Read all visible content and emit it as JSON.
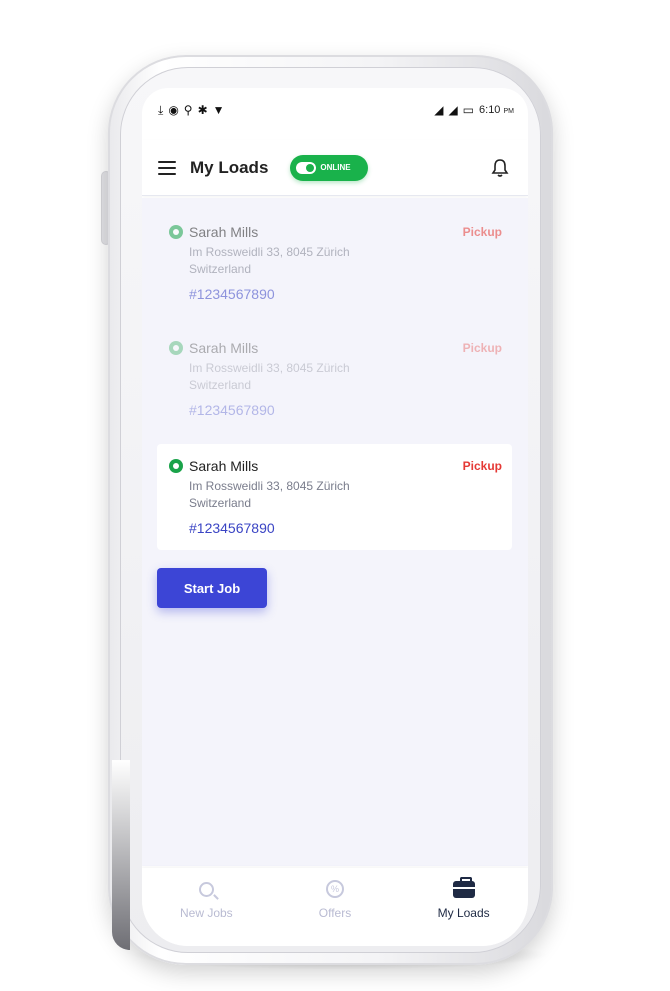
{
  "status_bar": {
    "left_icons": [
      "download-icon",
      "hotspot-icon",
      "location-icon",
      "bluetooth-icon",
      "wifi-icon"
    ],
    "right_icons": [
      "signal-icon",
      "signal-r-icon",
      "battery-icon"
    ],
    "time": "6:10",
    "ampm": "PM"
  },
  "header": {
    "title": "My Loads",
    "online_label": "ONLINE",
    "online_state": true
  },
  "loads": [
    {
      "name": "Sarah Mills",
      "type": "Pickup",
      "address_line1": "Im Rossweidli 33, 8045 Zürich",
      "address_line2": "Switzerland",
      "id": "#1234567890"
    },
    {
      "name": "Sarah Mills",
      "type": "Pickup",
      "address_line1": "Im Rossweidli 33, 8045 Zürich",
      "address_line2": "Switzerland",
      "id": "#1234567890"
    },
    {
      "name": "Sarah Mills",
      "type": "Pickup",
      "address_line1": "Im Rossweidli 33, 8045 Zürich",
      "address_line2": "Switzerland",
      "id": "#1234567890"
    }
  ],
  "actions": {
    "start_job": "Start Job"
  },
  "bottom_nav": [
    {
      "label": "New Jobs",
      "icon": "search-icon",
      "active": false
    },
    {
      "label": "Offers",
      "icon": "percent-badge-icon",
      "active": false
    },
    {
      "label": "My Loads",
      "icon": "briefcase-icon",
      "active": true
    }
  ],
  "colors": {
    "online_green": "#19b24b",
    "pickup_red": "#e53935",
    "id_blue": "#3a44c4",
    "primary_button": "#3c45d6",
    "background": "#f4f4fb"
  }
}
